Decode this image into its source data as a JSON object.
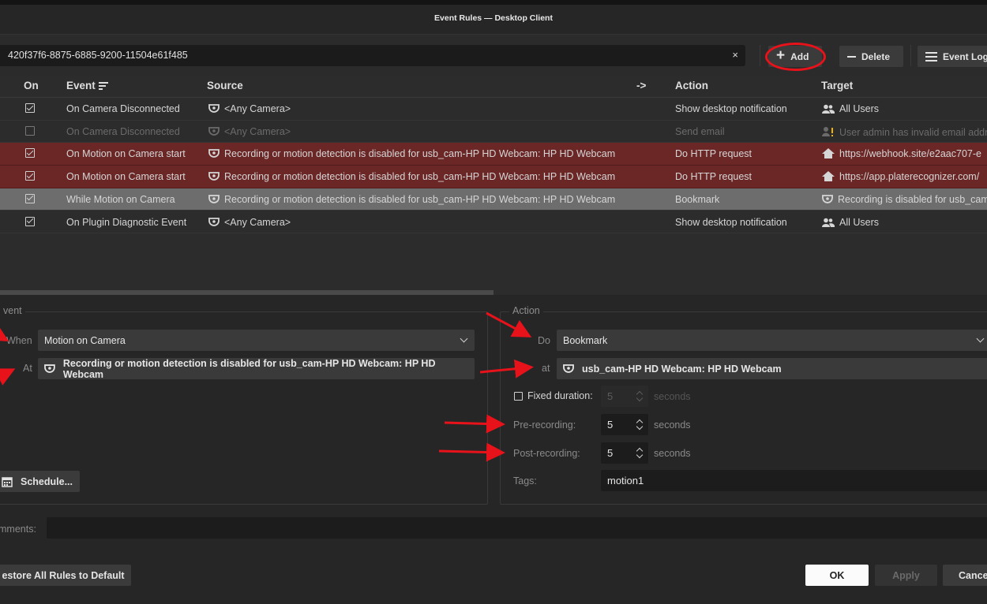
{
  "window": {
    "title": "Event Rules — Desktop Client"
  },
  "toolbar": {
    "search_value": "420f37f6-8875-6885-9200-11504e61f485",
    "clear_glyph": "×",
    "add_label": "Add",
    "delete_label": "Delete",
    "event_log_label": "Event Log"
  },
  "table": {
    "headers": {
      "on": "On",
      "event": "Event",
      "source": "Source",
      "arrow": "->",
      "action": "Action",
      "target": "Target"
    },
    "rows": [
      {
        "on": true,
        "event": "On Camera Disconnected",
        "source": "<Any Camera>",
        "action": "Show desktop notification",
        "target": "All Users",
        "target_icon": "users-icon",
        "state": "normal"
      },
      {
        "on": false,
        "event": "On Camera Disconnected",
        "source": "<Any Camera>",
        "action": "Send email",
        "target": "User admin has invalid email address",
        "target_icon": "user-warning-icon",
        "state": "disabled"
      },
      {
        "on": true,
        "event": "On Motion on Camera start",
        "source": "Recording or motion detection is disabled for usb_cam-HP HD Webcam: HP HD Webcam",
        "action": "Do HTTP request",
        "target": "https://webhook.site/e2aac707-e",
        "target_icon": "home-icon",
        "state": "error"
      },
      {
        "on": true,
        "event": "On Motion on Camera start",
        "source": "Recording or motion detection is disabled for usb_cam-HP HD Webcam: HP HD Webcam",
        "action": "Do HTTP request",
        "target": "https://app.platerecognizer.com/",
        "target_icon": "home-icon",
        "state": "error"
      },
      {
        "on": true,
        "event": "While Motion on Camera",
        "source": "Recording or motion detection is disabled for usb_cam-HP HD Webcam: HP HD Webcam",
        "action": "Bookmark",
        "target": "Recording is disabled for usb_cam",
        "target_icon": "camera-icon",
        "state": "selected"
      },
      {
        "on": true,
        "event": "On Plugin Diagnostic Event",
        "source": "<Any Camera>",
        "action": "Show desktop notification",
        "target": "All Users",
        "target_icon": "users-icon",
        "state": "normal"
      }
    ]
  },
  "event_panel": {
    "group_label": "vent",
    "when_label": "When",
    "when_value": "Motion on Camera",
    "at_label": "At",
    "at_value": "Recording or motion detection is disabled for usb_cam-HP HD Webcam: HP HD Webcam",
    "schedule_label": "Schedule..."
  },
  "action_panel": {
    "group_label": "Action",
    "do_label": "Do",
    "do_value": "Bookmark",
    "at_label": "at",
    "at_value": "usb_cam-HP HD Webcam: HP HD Webcam",
    "fixed_duration_label": "Fixed duration:",
    "fixed_duration_value": "5",
    "fixed_duration_unit": "seconds",
    "pre_recording_label": "Pre-recording:",
    "pre_recording_value": "5",
    "pre_recording_unit": "seconds",
    "post_recording_label": "Post-recording:",
    "post_recording_value": "5",
    "post_recording_unit": "seconds",
    "tags_label": "Tags:",
    "tags_value": "motion1"
  },
  "comments": {
    "label": "mments:",
    "value": ""
  },
  "footer": {
    "restore_label": "estore All Rules to Default",
    "ok_label": "OK",
    "apply_label": "Apply",
    "cancel_label": "Cance"
  },
  "colors": {
    "error_row": "#6b2626",
    "selected_row": "#6d6d6d",
    "annotation": "#e8121a"
  }
}
